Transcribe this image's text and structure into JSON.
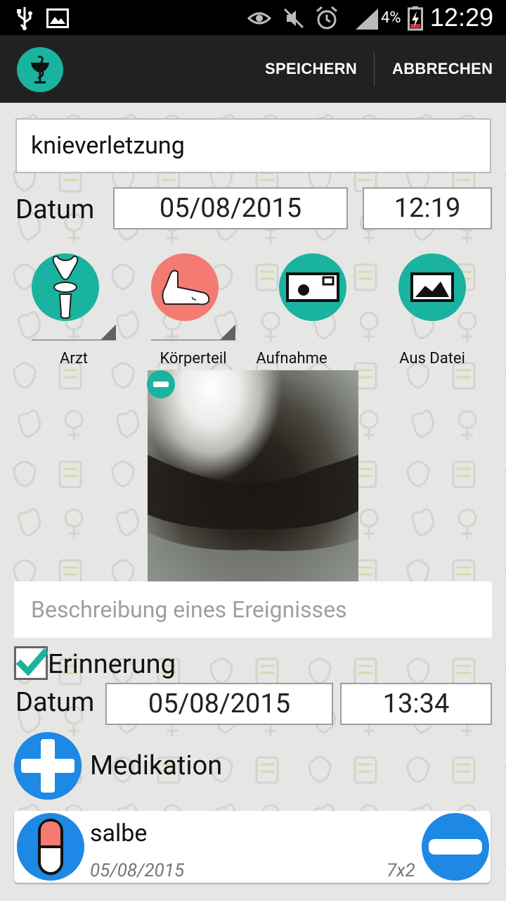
{
  "status_bar": {
    "battery_percent": "4%",
    "time": "12:29",
    "icons": [
      "usb-icon",
      "image-icon",
      "eye-icon",
      "mute-icon",
      "alarm-icon",
      "signal-icon",
      "battery-charging-icon"
    ]
  },
  "action_bar": {
    "logo_icon": "caduceus-icon",
    "save_label": "SPEICHERN",
    "cancel_label": "ABBRECHEN"
  },
  "event": {
    "title": "knieverletzung",
    "date_label": "Datum",
    "date": "05/08/2015",
    "time": "12:19",
    "description_placeholder": "Beschreibung eines Ereignisses"
  },
  "icon_buttons": [
    {
      "label": "Arzt",
      "icon": "bone-joint-icon",
      "color": "#1ab39f"
    },
    {
      "label": "Körperteil",
      "icon": "foot-icon",
      "color": "#f47a72"
    },
    {
      "label": "Aufnahme",
      "icon": "camera-icon",
      "color": "#1ab39f"
    },
    {
      "label": "Aus Datei",
      "icon": "image-file-icon",
      "color": "#1ab39f"
    }
  ],
  "reminder": {
    "label": "Erinnerung",
    "checked": true,
    "date_label": "Datum",
    "date": "05/08/2015",
    "time": "13:34"
  },
  "medication": {
    "label": "Medikation",
    "items": [
      {
        "name": "salbe",
        "date": "05/08/2015",
        "dosage": "7x2"
      }
    ]
  },
  "colors": {
    "accent": "#1ab39f",
    "blue": "#1e88e5",
    "coral": "#f47a72",
    "action_bar": "#212121"
  }
}
